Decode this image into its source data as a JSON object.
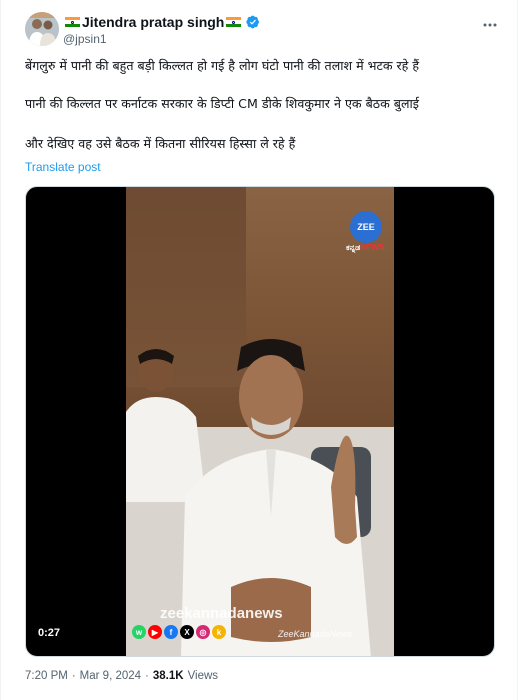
{
  "author": {
    "display_name": "Jitendra pratap singh",
    "handle": "@jpsin1",
    "verified_color": "#1d9bf0"
  },
  "post": {
    "lines": [
      "बेंगलुरु में पानी की बहुत बड़ी किल्लत हो गई है लोग घंटो पानी की तलाश में भटक रहे हैं",
      "पानी की किल्लत पर कर्नाटक सरकार के डिप्टी CM डीके शिवकुमार ने एक बैठक  बुलाई",
      "और देखिए वह उसे बैठक में कितना सीरियस हिस्सा ले रहे हैं"
    ],
    "translate_label": "Translate post"
  },
  "video": {
    "channel_logo_text": "ZEE",
    "channel_sub_left": "ಕನ್ನಡ",
    "channel_sub_right": "NEWS",
    "watermark": "zeekannadanews",
    "watermark_sub": "ZeeKannadaNews",
    "duration": "0:27"
  },
  "meta": {
    "time": "7:20 PM",
    "date": "Mar 9, 2024",
    "views_count": "38.1K",
    "views_label": "Views"
  }
}
